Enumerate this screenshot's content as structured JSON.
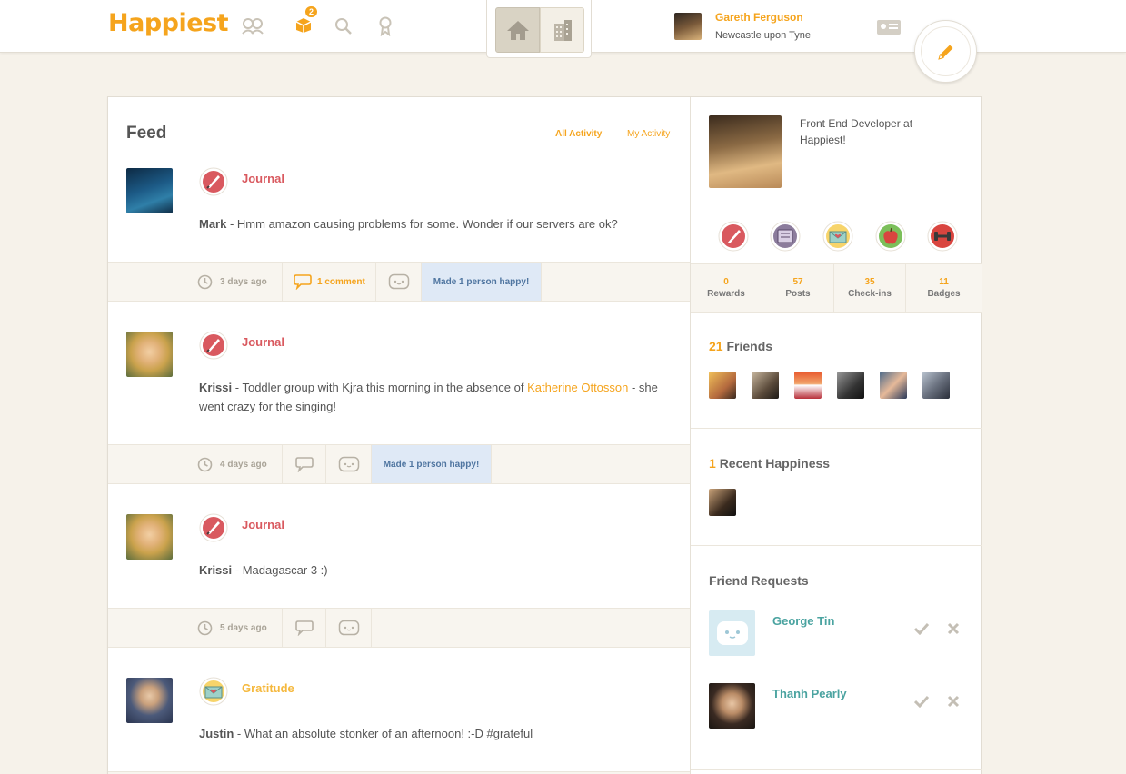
{
  "header": {
    "logo": "Happiest",
    "notifications_count": "2",
    "user": {
      "name": "Gareth Ferguson",
      "location": "Newcastle upon Tyne"
    }
  },
  "feed": {
    "title": "Feed",
    "filters": {
      "all": "All Activity",
      "mine": "My Activity"
    },
    "posts": [
      {
        "category": "Journal",
        "category_color": "#d9595f",
        "author": "Mark",
        "text": " - Hmm amazon causing problems for some. Wonder if our servers are ok?",
        "time": "3 days ago",
        "comments": "1 comment",
        "happy": "Made 1 person happy!"
      },
      {
        "category": "Journal",
        "category_color": "#d9595f",
        "author": "Krissi",
        "text_before": " - Toddler group with Kjra this morning in the absence of ",
        "mention": "Katherine Ottosson",
        "text_after": " - she went crazy for the singing!",
        "time": "4 days ago",
        "happy": "Made 1 person happy!"
      },
      {
        "category": "Journal",
        "category_color": "#d9595f",
        "author": "Krissi",
        "text": " - Madagascar 3 :)",
        "time": "5 days ago"
      },
      {
        "category": "Gratitude",
        "category_color": "#f5b83d",
        "author": "Justin",
        "text": " - What an absolute stonker of an afternoon! :-D #grateful"
      }
    ]
  },
  "profile": {
    "bio": "Front End Developer at Happiest!",
    "badges": [
      "journal-badge-icon",
      "book-badge-icon",
      "gratitude-badge-icon",
      "apple-badge-icon",
      "dumbbell-badge-icon"
    ],
    "stats": [
      {
        "value": "0",
        "label": "Rewards"
      },
      {
        "value": "57",
        "label": "Posts"
      },
      {
        "value": "35",
        "label": "Check-ins"
      },
      {
        "value": "11",
        "label": "Badges"
      }
    ]
  },
  "friends": {
    "count": "21",
    "label": "Friends"
  },
  "recent": {
    "count": "1",
    "label": "Recent Happiness"
  },
  "requests": {
    "title": "Friend Requests",
    "items": [
      {
        "name": "George Tin"
      },
      {
        "name": "Thanh Pearly"
      }
    ]
  },
  "colors": {
    "accent": "#f5a41d",
    "teal": "#4aa3a0",
    "happy_bg": "#dfe9f6"
  }
}
